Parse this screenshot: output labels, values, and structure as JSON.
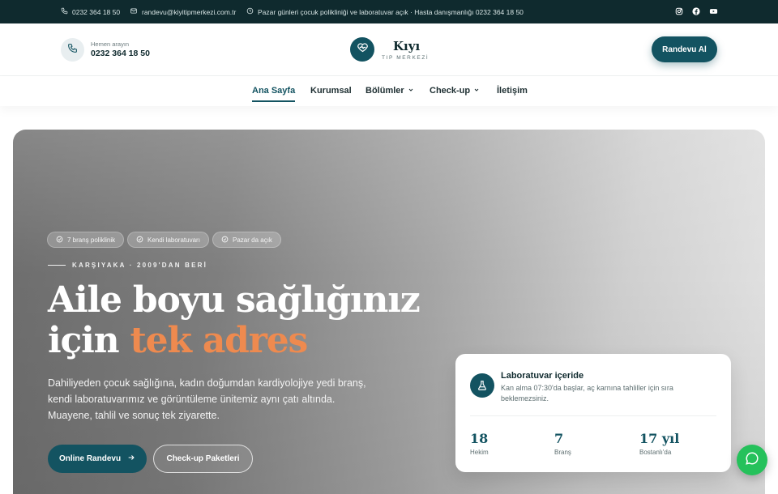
{
  "topbar": {
    "phone": "0232 364 18 50",
    "email": "randevu@kiyitipmerkezi.com.tr",
    "notice": "Pazar günleri çocuk polikliniği ve laboratuvar açık · Hasta danışmanlığı 0232 364 18 50",
    "social_icons": [
      "instagram-icon",
      "facebook-icon",
      "youtube-icon"
    ]
  },
  "header": {
    "call_caption": "Hemen arayın",
    "call_number": "0232 364 18 50",
    "logo_name": "Kıyı",
    "logo_sub": "TIP MERKEZİ",
    "cta_label": "Randevu Al"
  },
  "nav": {
    "items": [
      {
        "label": "Ana Sayfa",
        "active": true
      },
      {
        "label": "Kurumsal"
      },
      {
        "label": "Bölümler",
        "dropdown": true
      },
      {
        "label": "Check-up",
        "dropdown": true
      },
      {
        "label": "İletişim"
      }
    ]
  },
  "hero": {
    "chips": [
      "7 branş poliklinik",
      "Kendi laboratuvarı",
      "Pazar da açık"
    ],
    "eyebrow": "KARŞIYAKA · 2009'DAN BERİ",
    "headline_line1": "Aile boyu sağlığınız",
    "headline_line2_prefix": "için ",
    "headline_accent": "tek adres",
    "text": "Dahiliyeden çocuk sağlığına, kadın doğumdan kardiyolojiye yedi branş, kendi laboratuvarımız ve görüntüleme ünitemiz aynı çatı altında. Muayene, tahlil ve sonuç tek ziyarette.",
    "primary_button": "Online Randevu",
    "secondary_button": "Check-up Paketleri"
  },
  "lab_card": {
    "title": "Laboratuvar içeride",
    "description": "Kan alma 07:30'da başlar, aç karnına tahliller için sıra beklemezsiniz.",
    "stats": [
      {
        "value": "18",
        "label": "Hekim"
      },
      {
        "value": "7",
        "label": "Branş"
      },
      {
        "value": "17 yıl",
        "label": "Bostanlı'da"
      }
    ]
  },
  "colors": {
    "brand": "#135361",
    "topbar_bg": "#0f2a2e",
    "accent": "#ee8a4f",
    "chat": "#25c15b"
  }
}
